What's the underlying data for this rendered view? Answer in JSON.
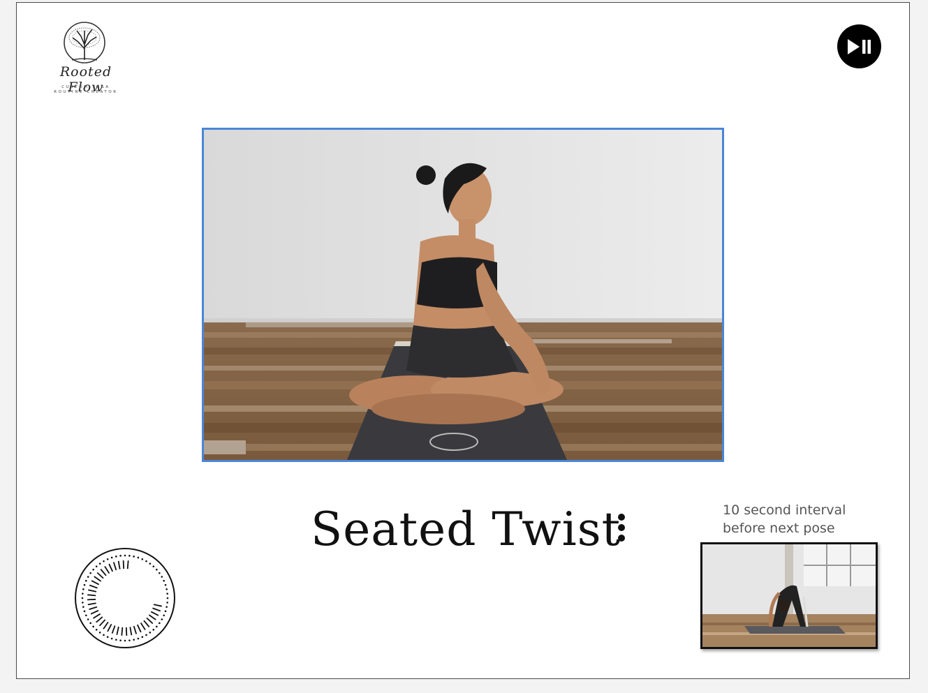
{
  "brand": {
    "name": "Rooted Flow",
    "tagline_line1": "CUSTOM YOGA",
    "tagline_line2": "ROUTINE CREATOR"
  },
  "controls": {
    "play_pause_icon": "play-pause-icon",
    "menu_icon": "vertical-ellipsis-icon"
  },
  "pose": {
    "title": "Seated Twist",
    "image_alt": "seated-twist-pose-photo"
  },
  "timer": {
    "icon": "countdown-timer-icon"
  },
  "next_pose": {
    "interval_line1": "10 second interval",
    "interval_line2": "before next pose",
    "image_alt": "next-pose-preview-photo"
  },
  "colors": {
    "accent_border": "#4a86d6",
    "text_dark": "#111111",
    "text_muted": "#555555"
  }
}
